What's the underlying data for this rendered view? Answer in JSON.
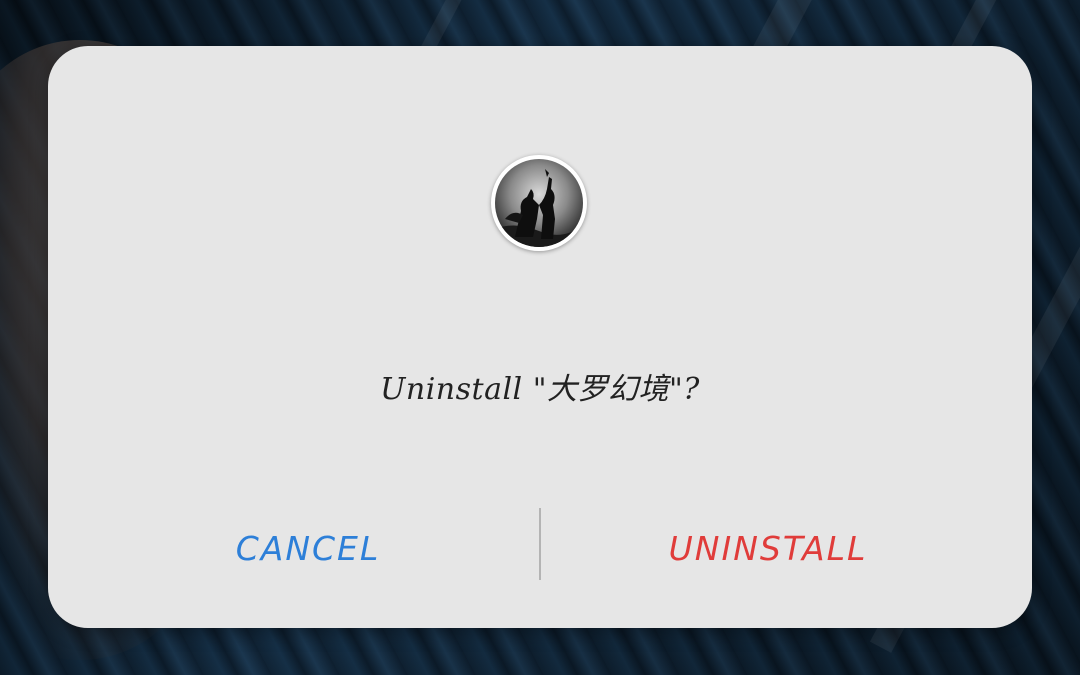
{
  "dialog": {
    "message": "Uninstall \"大罗幻境\"?",
    "cancel_label": "CANCEL",
    "uninstall_label": "UNINSTALL"
  },
  "app": {
    "icon": "app-icon-silhouette"
  },
  "colors": {
    "dialog_background": "#e6e6e6",
    "cancel": "#2d7fd8",
    "uninstall": "#e03c3a",
    "message": "#222222"
  }
}
